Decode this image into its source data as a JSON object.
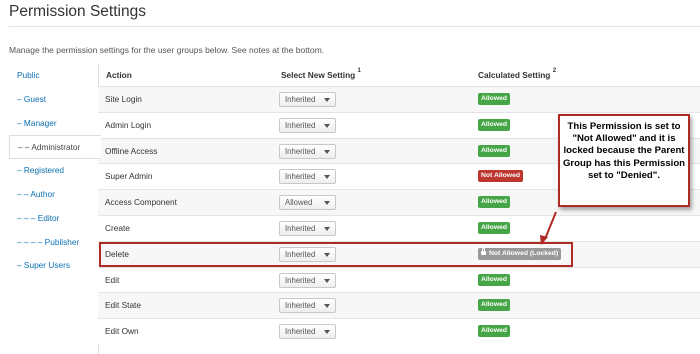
{
  "page": {
    "title": "Permission Settings",
    "intro": "Manage the permission settings for the user groups below. See notes at the bottom."
  },
  "sidebar": {
    "items": [
      {
        "label": "Public",
        "active": false
      },
      {
        "label": "– Guest",
        "active": false
      },
      {
        "label": "– Manager",
        "active": false
      },
      {
        "label": "– – Administrator",
        "active": true
      },
      {
        "label": "– Registered",
        "active": false
      },
      {
        "label": "– – Author",
        "active": false
      },
      {
        "label": "– – – Editor",
        "active": false
      },
      {
        "label": "– – – – Publisher",
        "active": false
      },
      {
        "label": "– Super Users",
        "active": false
      }
    ]
  },
  "table": {
    "headers": {
      "action": "Action",
      "select": "Select New Setting",
      "select_sup": "1",
      "calculated": "Calculated Setting",
      "calculated_sup": "2"
    },
    "rows": [
      {
        "action": "Site Login",
        "setting": "Inherited",
        "calculated": "Allowed",
        "status": "allowed"
      },
      {
        "action": "Admin Login",
        "setting": "Inherited",
        "calculated": "Allowed",
        "status": "allowed"
      },
      {
        "action": "Offline Access",
        "setting": "Inherited",
        "calculated": "Allowed",
        "status": "allowed"
      },
      {
        "action": "Super Admin",
        "setting": "Inherited",
        "calculated": "Not Allowed",
        "status": "notallowed"
      },
      {
        "action": "Access Component",
        "setting": "Allowed",
        "calculated": "Allowed",
        "status": "allowed"
      },
      {
        "action": "Create",
        "setting": "Inherited",
        "calculated": "Allowed",
        "status": "allowed"
      },
      {
        "action": "Delete",
        "setting": "Inherited",
        "calculated": "Not Allowed (Locked)",
        "status": "locked"
      },
      {
        "action": "Edit",
        "setting": "Inherited",
        "calculated": "Allowed",
        "status": "allowed"
      },
      {
        "action": "Edit State",
        "setting": "Inherited",
        "calculated": "Allowed",
        "status": "allowed"
      },
      {
        "action": "Edit Own",
        "setting": "Inherited",
        "calculated": "Allowed",
        "status": "allowed"
      }
    ]
  },
  "callout": {
    "text": "This Permission is set to \"Not Allowed\" and it is locked because the Parent Group has this Permission set to \"Denied\"."
  },
  "icons": {
    "select_caret": "chevron-down-icon",
    "lock": "lock-icon"
  },
  "colors": {
    "allowed": "#46a546",
    "not_allowed": "#bd362f",
    "locked": "#999999",
    "highlight": "#b02a24",
    "link": "#0a6fb0"
  }
}
